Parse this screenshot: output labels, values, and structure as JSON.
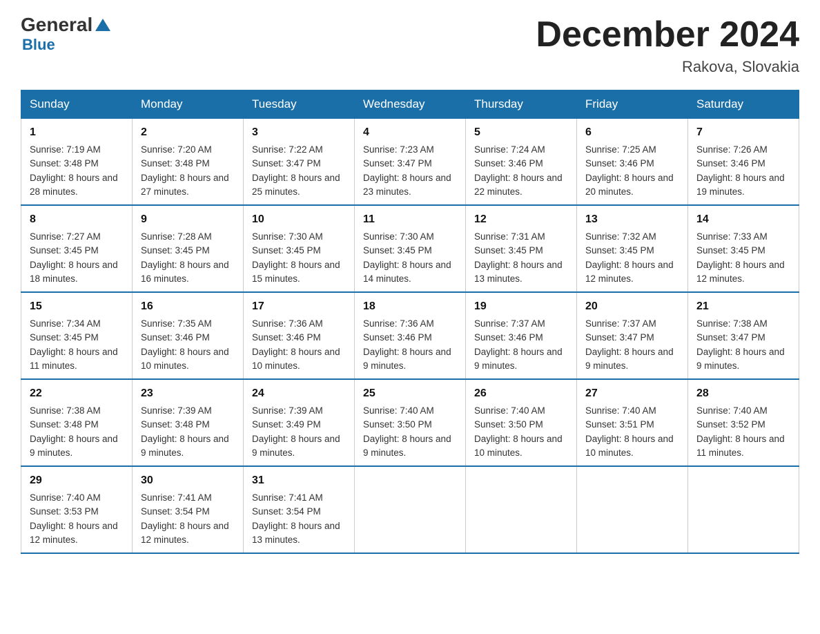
{
  "header": {
    "logo_general": "General",
    "logo_blue": "Blue",
    "title": "December 2024",
    "subtitle": "Rakova, Slovakia"
  },
  "days_of_week": [
    "Sunday",
    "Monday",
    "Tuesday",
    "Wednesday",
    "Thursday",
    "Friday",
    "Saturday"
  ],
  "weeks": [
    [
      {
        "day": "1",
        "sunrise": "7:19 AM",
        "sunset": "3:48 PM",
        "daylight": "8 hours and 28 minutes."
      },
      {
        "day": "2",
        "sunrise": "7:20 AM",
        "sunset": "3:48 PM",
        "daylight": "8 hours and 27 minutes."
      },
      {
        "day": "3",
        "sunrise": "7:22 AM",
        "sunset": "3:47 PM",
        "daylight": "8 hours and 25 minutes."
      },
      {
        "day": "4",
        "sunrise": "7:23 AM",
        "sunset": "3:47 PM",
        "daylight": "8 hours and 23 minutes."
      },
      {
        "day": "5",
        "sunrise": "7:24 AM",
        "sunset": "3:46 PM",
        "daylight": "8 hours and 22 minutes."
      },
      {
        "day": "6",
        "sunrise": "7:25 AM",
        "sunset": "3:46 PM",
        "daylight": "8 hours and 20 minutes."
      },
      {
        "day": "7",
        "sunrise": "7:26 AM",
        "sunset": "3:46 PM",
        "daylight": "8 hours and 19 minutes."
      }
    ],
    [
      {
        "day": "8",
        "sunrise": "7:27 AM",
        "sunset": "3:45 PM",
        "daylight": "8 hours and 18 minutes."
      },
      {
        "day": "9",
        "sunrise": "7:28 AM",
        "sunset": "3:45 PM",
        "daylight": "8 hours and 16 minutes."
      },
      {
        "day": "10",
        "sunrise": "7:30 AM",
        "sunset": "3:45 PM",
        "daylight": "8 hours and 15 minutes."
      },
      {
        "day": "11",
        "sunrise": "7:30 AM",
        "sunset": "3:45 PM",
        "daylight": "8 hours and 14 minutes."
      },
      {
        "day": "12",
        "sunrise": "7:31 AM",
        "sunset": "3:45 PM",
        "daylight": "8 hours and 13 minutes."
      },
      {
        "day": "13",
        "sunrise": "7:32 AM",
        "sunset": "3:45 PM",
        "daylight": "8 hours and 12 minutes."
      },
      {
        "day": "14",
        "sunrise": "7:33 AM",
        "sunset": "3:45 PM",
        "daylight": "8 hours and 12 minutes."
      }
    ],
    [
      {
        "day": "15",
        "sunrise": "7:34 AM",
        "sunset": "3:45 PM",
        "daylight": "8 hours and 11 minutes."
      },
      {
        "day": "16",
        "sunrise": "7:35 AM",
        "sunset": "3:46 PM",
        "daylight": "8 hours and 10 minutes."
      },
      {
        "day": "17",
        "sunrise": "7:36 AM",
        "sunset": "3:46 PM",
        "daylight": "8 hours and 10 minutes."
      },
      {
        "day": "18",
        "sunrise": "7:36 AM",
        "sunset": "3:46 PM",
        "daylight": "8 hours and 9 minutes."
      },
      {
        "day": "19",
        "sunrise": "7:37 AM",
        "sunset": "3:46 PM",
        "daylight": "8 hours and 9 minutes."
      },
      {
        "day": "20",
        "sunrise": "7:37 AM",
        "sunset": "3:47 PM",
        "daylight": "8 hours and 9 minutes."
      },
      {
        "day": "21",
        "sunrise": "7:38 AM",
        "sunset": "3:47 PM",
        "daylight": "8 hours and 9 minutes."
      }
    ],
    [
      {
        "day": "22",
        "sunrise": "7:38 AM",
        "sunset": "3:48 PM",
        "daylight": "8 hours and 9 minutes."
      },
      {
        "day": "23",
        "sunrise": "7:39 AM",
        "sunset": "3:48 PM",
        "daylight": "8 hours and 9 minutes."
      },
      {
        "day": "24",
        "sunrise": "7:39 AM",
        "sunset": "3:49 PM",
        "daylight": "8 hours and 9 minutes."
      },
      {
        "day": "25",
        "sunrise": "7:40 AM",
        "sunset": "3:50 PM",
        "daylight": "8 hours and 9 minutes."
      },
      {
        "day": "26",
        "sunrise": "7:40 AM",
        "sunset": "3:50 PM",
        "daylight": "8 hours and 10 minutes."
      },
      {
        "day": "27",
        "sunrise": "7:40 AM",
        "sunset": "3:51 PM",
        "daylight": "8 hours and 10 minutes."
      },
      {
        "day": "28",
        "sunrise": "7:40 AM",
        "sunset": "3:52 PM",
        "daylight": "8 hours and 11 minutes."
      }
    ],
    [
      {
        "day": "29",
        "sunrise": "7:40 AM",
        "sunset": "3:53 PM",
        "daylight": "8 hours and 12 minutes."
      },
      {
        "day": "30",
        "sunrise": "7:41 AM",
        "sunset": "3:54 PM",
        "daylight": "8 hours and 12 minutes."
      },
      {
        "day": "31",
        "sunrise": "7:41 AM",
        "sunset": "3:54 PM",
        "daylight": "8 hours and 13 minutes."
      },
      null,
      null,
      null,
      null
    ]
  ],
  "labels": {
    "sunrise": "Sunrise:",
    "sunset": "Sunset:",
    "daylight": "Daylight:"
  }
}
